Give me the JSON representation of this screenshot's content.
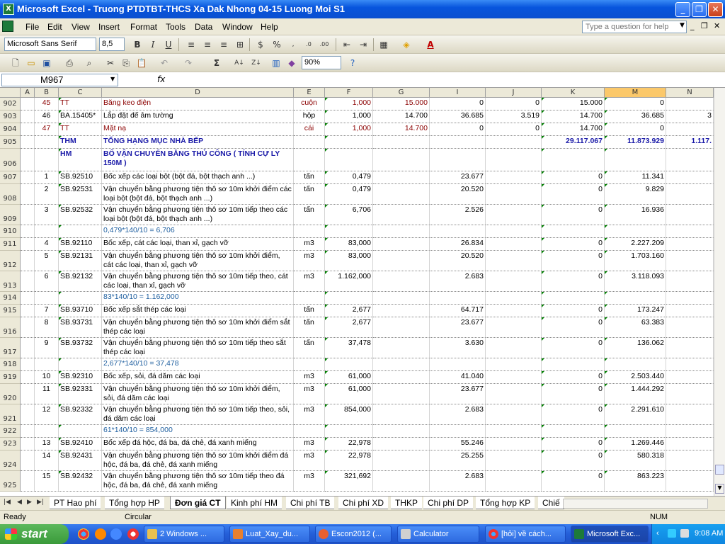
{
  "window": {
    "title": "Microsoft Excel - Truong PTDTBT-THCS Xa Dak Nhong 04-15 Luong Moi S1"
  },
  "menu": [
    "File",
    "Edit",
    "View",
    "Insert",
    "Format",
    "Tools",
    "Data",
    "Window",
    "Help"
  ],
  "help_placeholder": "Type a question for help",
  "toolbar": {
    "font_name": "Microsoft Sans Serif",
    "font_size": "8,5",
    "zoom": "90%"
  },
  "formula_bar": {
    "name_box": "M967",
    "fx": "fx",
    "formula": ""
  },
  "columns": [
    "A",
    "B",
    "C",
    "D",
    "E",
    "F",
    "G",
    "I",
    "J",
    "K",
    "M",
    "N"
  ],
  "selected_column": "M",
  "rows": [
    {
      "num": "902",
      "b": "45",
      "c": "TT",
      "d": "Băng keo điện",
      "e": "cuộn",
      "f": "1,000",
      "g": "15.000",
      "i": "0",
      "j": "0",
      "k": "15.000",
      "m": "0",
      "n": "",
      "style": "red"
    },
    {
      "num": "903",
      "b": "46",
      "c": "BA.15405*",
      "d": "Lắp đặt đế âm tường",
      "e": "hộp",
      "f": "1,000",
      "g": "14.700",
      "i": "36.685",
      "j": "3.519",
      "k": "14.700",
      "m": "36.685",
      "n": "3",
      "style": ""
    },
    {
      "num": "904",
      "b": "47",
      "c": "TT",
      "d": "Mặt nạ",
      "e": "cái",
      "f": "1,000",
      "g": "14.700",
      "i": "0",
      "j": "0",
      "k": "14.700",
      "m": "0",
      "n": "",
      "style": "red"
    },
    {
      "num": "905",
      "b": "",
      "c": "THM",
      "d": "TỔNG HẠNG MỤC NHÀ BẾP",
      "e": "",
      "f": "",
      "g": "",
      "i": "",
      "j": "",
      "k": "29.117.067",
      "m": "11.873.929",
      "n": "1.117.",
      "style": "blue"
    },
    {
      "num": "906",
      "b": "",
      "c": "HM",
      "d": "BỐ VẬN CHUYỂN BẰNG THỦ CÔNG ( TÍNH CỰ LY 150M )",
      "e": "",
      "f": "",
      "g": "",
      "i": "",
      "j": "",
      "k": "",
      "m": "",
      "n": "",
      "style": "blue"
    },
    {
      "num": "907",
      "b": "1",
      "c": "SB.92510",
      "d": "Bốc xếp các loại bột (bột đá, bột thạch anh ...)",
      "e": "tấn",
      "f": "0,479",
      "g": "",
      "i": "23.677",
      "j": "",
      "k": "0",
      "m": "11.341",
      "n": "",
      "style": ""
    },
    {
      "num": "908",
      "b": "2",
      "c": "SB.92531",
      "d": "Vận chuyển bằng phương tiện thô sơ 10m khởi điểm các loại bột (bột đá, bột thạch anh ...)",
      "e": "tấn",
      "f": "0,479",
      "g": "",
      "i": "20.520",
      "j": "",
      "k": "0",
      "m": "9.829",
      "n": "",
      "style": ""
    },
    {
      "num": "909",
      "b": "3",
      "c": "SB.92532",
      "d": "Vận chuyển bằng phương tiện thô sơ 10m tiếp theo các loại bột (bột đá, bột thạch anh ...)",
      "e": "tấn",
      "f": "6,706",
      "g": "",
      "i": "2.526",
      "j": "",
      "k": "0",
      "m": "16.936",
      "n": "",
      "style": ""
    },
    {
      "num": "910",
      "b": "",
      "c": "",
      "d": "0,479*140/10 = 6,706",
      "e": "",
      "f": "",
      "g": "",
      "i": "",
      "j": "",
      "k": "",
      "m": "",
      "n": "",
      "style": "note"
    },
    {
      "num": "911",
      "b": "4",
      "c": "SB.92110",
      "d": "Bốc xếp, cát các loại, than xỉ, gạch vỡ",
      "e": "m3",
      "f": "83,000",
      "g": "",
      "i": "26.834",
      "j": "",
      "k": "0",
      "m": "2.227.209",
      "n": "",
      "style": ""
    },
    {
      "num": "912",
      "b": "5",
      "c": "SB.92131",
      "d": "Vận chuyển bằng phương tiện thô sơ 10m khởi điểm, cát các loại, than xỉ, gạch vỡ",
      "e": "m3",
      "f": "83,000",
      "g": "",
      "i": "20.520",
      "j": "",
      "k": "0",
      "m": "1.703.160",
      "n": "",
      "style": ""
    },
    {
      "num": "913",
      "b": "6",
      "c": "SB.92132",
      "d": "Vận chuyển bằng phương tiện thô sơ 10m tiếp theo, cát các loại, than xỉ, gạch vỡ",
      "e": "m3",
      "f": "1.162,000",
      "g": "",
      "i": "2.683",
      "j": "",
      "k": "0",
      "m": "3.118.093",
      "n": "",
      "style": ""
    },
    {
      "num": "914",
      "b": "",
      "c": "",
      "d": "83*140/10 = 1.162,000",
      "e": "",
      "f": "",
      "g": "",
      "i": "",
      "j": "",
      "k": "",
      "m": "",
      "n": "",
      "style": "note"
    },
    {
      "num": "915",
      "b": "7",
      "c": "SB.93710",
      "d": "Bốc xếp sắt thép các loại",
      "e": "tấn",
      "f": "2,677",
      "g": "",
      "i": "64.717",
      "j": "",
      "k": "0",
      "m": "173.247",
      "n": "",
      "style": ""
    },
    {
      "num": "916",
      "b": "8",
      "c": "SB.93731",
      "d": "Vận chuyển bằng phương tiện thô sơ 10m khởi điểm sắt thép các loại",
      "e": "tấn",
      "f": "2,677",
      "g": "",
      "i": "23.677",
      "j": "",
      "k": "0",
      "m": "63.383",
      "n": "",
      "style": ""
    },
    {
      "num": "917",
      "b": "9",
      "c": "SB.93732",
      "d": "Vận chuyển bằng phương tiện thô sơ 10m tiếp theo sắt thép các loại",
      "e": "tấn",
      "f": "37,478",
      "g": "",
      "i": "3.630",
      "j": "",
      "k": "0",
      "m": "136.062",
      "n": "",
      "style": ""
    },
    {
      "num": "918",
      "b": "",
      "c": "",
      "d": "2,677*140/10 = 37,478",
      "e": "",
      "f": "",
      "g": "",
      "i": "",
      "j": "",
      "k": "",
      "m": "",
      "n": "",
      "style": "note"
    },
    {
      "num": "919",
      "b": "10",
      "c": "SB.92310",
      "d": "Bốc xếp, sỏi, đá dăm các loại",
      "e": "m3",
      "f": "61,000",
      "g": "",
      "i": "41.040",
      "j": "",
      "k": "0",
      "m": "2.503.440",
      "n": "",
      "style": ""
    },
    {
      "num": "920",
      "b": "11",
      "c": "SB.92331",
      "d": "Vận chuyển bằng phương tiện thô sơ 10m khởi điểm, sỏi, đá dăm các loại",
      "e": "m3",
      "f": "61,000",
      "g": "",
      "i": "23.677",
      "j": "",
      "k": "0",
      "m": "1.444.292",
      "n": "",
      "style": ""
    },
    {
      "num": "921",
      "b": "12",
      "c": "SB.92332",
      "d": "Vận chuyển bằng phương tiện thô sơ 10m tiếp theo, sỏi, đá dăm các loại",
      "e": "m3",
      "f": "854,000",
      "g": "",
      "i": "2.683",
      "j": "",
      "k": "0",
      "m": "2.291.610",
      "n": "",
      "style": ""
    },
    {
      "num": "922",
      "b": "",
      "c": "",
      "d": "61*140/10 = 854,000",
      "e": "",
      "f": "",
      "g": "",
      "i": "",
      "j": "",
      "k": "",
      "m": "",
      "n": "",
      "style": "note"
    },
    {
      "num": "923",
      "b": "13",
      "c": "SB.92410",
      "d": "Bốc xếp đá hộc, đá ba, đá chẻ, đá xanh miếng",
      "e": "m3",
      "f": "22,978",
      "g": "",
      "i": "55.246",
      "j": "",
      "k": "0",
      "m": "1.269.446",
      "n": "",
      "style": ""
    },
    {
      "num": "924",
      "b": "14",
      "c": "SB.92431",
      "d": "Vận chuyển bằng phương tiện thô sơ 10m khởi điểm đá hộc, đá ba, đá chẻ, đá xanh miếng",
      "e": "m3",
      "f": "22,978",
      "g": "",
      "i": "25.255",
      "j": "",
      "k": "0",
      "m": "580.318",
      "n": "",
      "style": ""
    },
    {
      "num": "925",
      "b": "15",
      "c": "SB.92432",
      "d": "Vận chuyển bằng phương tiện thô sơ 10m tiếp theo đá hộc, đá ba, đá chẻ, đá xanh miếng",
      "e": "m3",
      "f": "321,692",
      "g": "",
      "i": "2.683",
      "j": "",
      "k": "0",
      "m": "863.223",
      "n": "",
      "style": ""
    }
  ],
  "sheet_tabs": [
    "PT Hao phí",
    "Tổng hợp HP",
    "Đơn giá CT",
    "Kinh phí HM",
    "Chi phí TB",
    "Chi phí XD",
    "THKP",
    "Chi phí DP",
    "Tổng hợp KP",
    "Chiế"
  ],
  "active_tab": "Đơn giá CT",
  "status": {
    "left": "Ready",
    "middle": "Circular",
    "right": "NUM"
  },
  "taskbar": {
    "start": "start",
    "buttons": [
      "2 Windows ...",
      "Luat_Xay_du...",
      "Escon2012 (...",
      "Calculator",
      "[hỏi] về cách...",
      "Microsoft Exc..."
    ],
    "clock": "9:08 AM"
  }
}
